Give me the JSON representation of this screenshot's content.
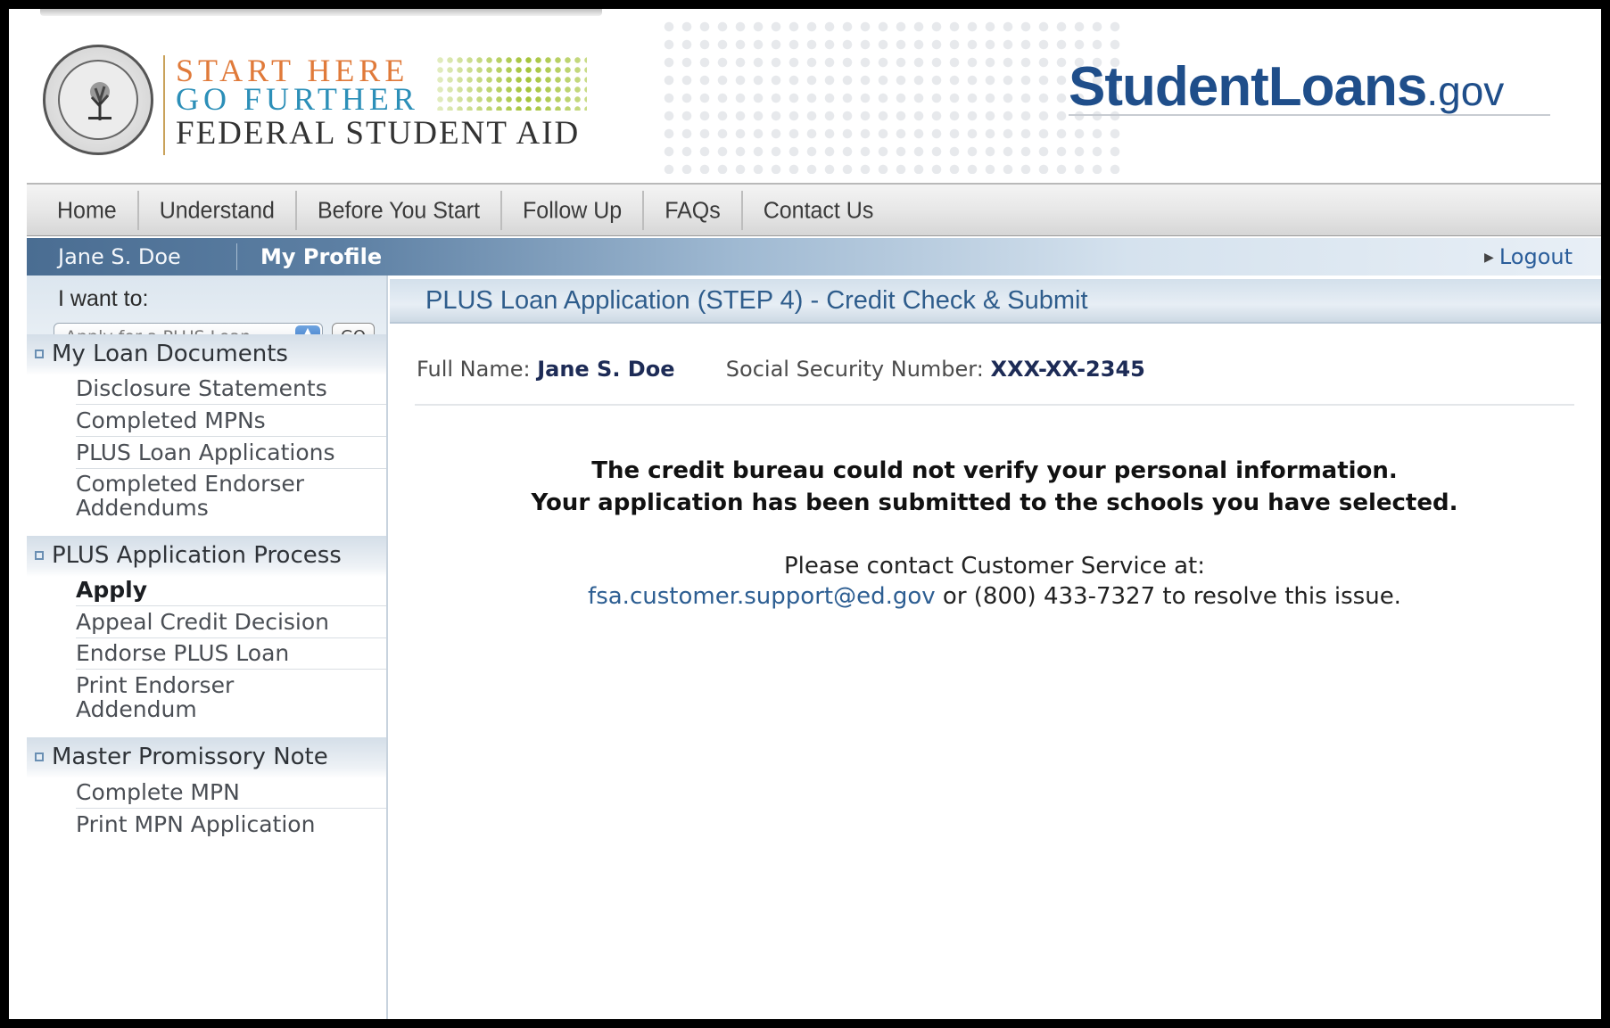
{
  "header": {
    "logo_line1": "START HERE",
    "logo_line2": "GO FURTHER",
    "logo_line3": "FEDERAL STUDENT AID",
    "brand_main": "StudentLoans",
    "brand_tld": ".gov"
  },
  "topnav": {
    "items": [
      "Home",
      "Understand",
      "Before You Start",
      "Follow Up",
      "FAQs",
      "Contact Us"
    ]
  },
  "userbar": {
    "user_name": "Jane S. Doe",
    "my_profile": "My Profile",
    "logout": "Logout"
  },
  "sidebar": {
    "iwant_label": "I want to:",
    "iwant_selected": "Apply for a PLUS Loan",
    "go_label": "GO",
    "sections": [
      {
        "title": "My Loan Documents",
        "items": [
          "Disclosure Statements",
          "Completed MPNs",
          "PLUS Loan Applications",
          "Completed Endorser Addendums"
        ]
      },
      {
        "title": "PLUS Application Process",
        "items": [
          "Apply",
          "Appeal Credit Decision",
          "Endorse PLUS Loan",
          "Print Endorser Addendum"
        ]
      },
      {
        "title": "Master Promissory Note",
        "items": [
          "Complete MPN",
          "Print MPN Application"
        ]
      }
    ]
  },
  "main": {
    "title": "PLUS Loan Application (STEP 4) - Credit Check & Submit",
    "full_name_label": "Full Name:",
    "full_name_value": "Jane S. Doe",
    "ssn_label": "Social Security Number:",
    "ssn_value": "XXX-XX-2345",
    "message_line1": "The credit bureau could not verify your personal information.",
    "message_line2": "Your application has been submitted to the schools you have selected.",
    "contact_line1": "Please contact Customer Service at:",
    "contact_email": "fsa.customer.support@ed.gov",
    "contact_rest": " or (800) 433-7327 to resolve this issue."
  }
}
